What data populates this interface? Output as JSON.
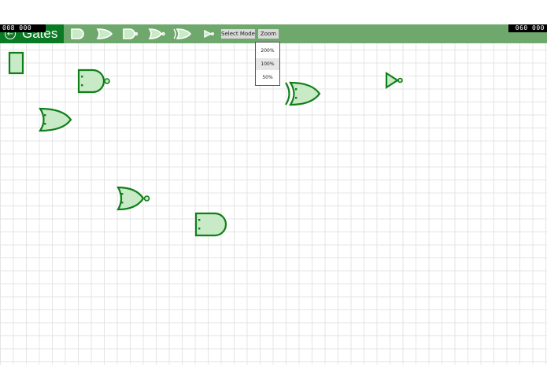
{
  "header": {
    "title": "Gates",
    "counter_left": "008 000",
    "counter_right": "060 000"
  },
  "toolbar": {
    "tools": [
      {
        "icon": "and-gate-icon"
      },
      {
        "icon": "or-gate-icon"
      },
      {
        "icon": "nand-gate-icon"
      },
      {
        "icon": "nor-gate-icon"
      },
      {
        "icon": "xor-gate-icon"
      },
      {
        "icon": "not-gate-icon"
      }
    ],
    "select_mode_label": "Select Mode",
    "zoom_label": "Zoom"
  },
  "zoom_menu": {
    "options": [
      "200%",
      "100%",
      "50%"
    ],
    "selected": "100%"
  },
  "canvas": {
    "gates": [
      {
        "type": "input"
      },
      {
        "type": "nand"
      },
      {
        "type": "or"
      },
      {
        "type": "xor"
      },
      {
        "type": "not"
      },
      {
        "type": "nor"
      },
      {
        "type": "and"
      }
    ]
  },
  "colors": {
    "appbar": "#6fa86c",
    "title_block": "#0a7a24",
    "gate_stroke": "#0f7f1a",
    "gate_fill": "#c8eac6"
  }
}
